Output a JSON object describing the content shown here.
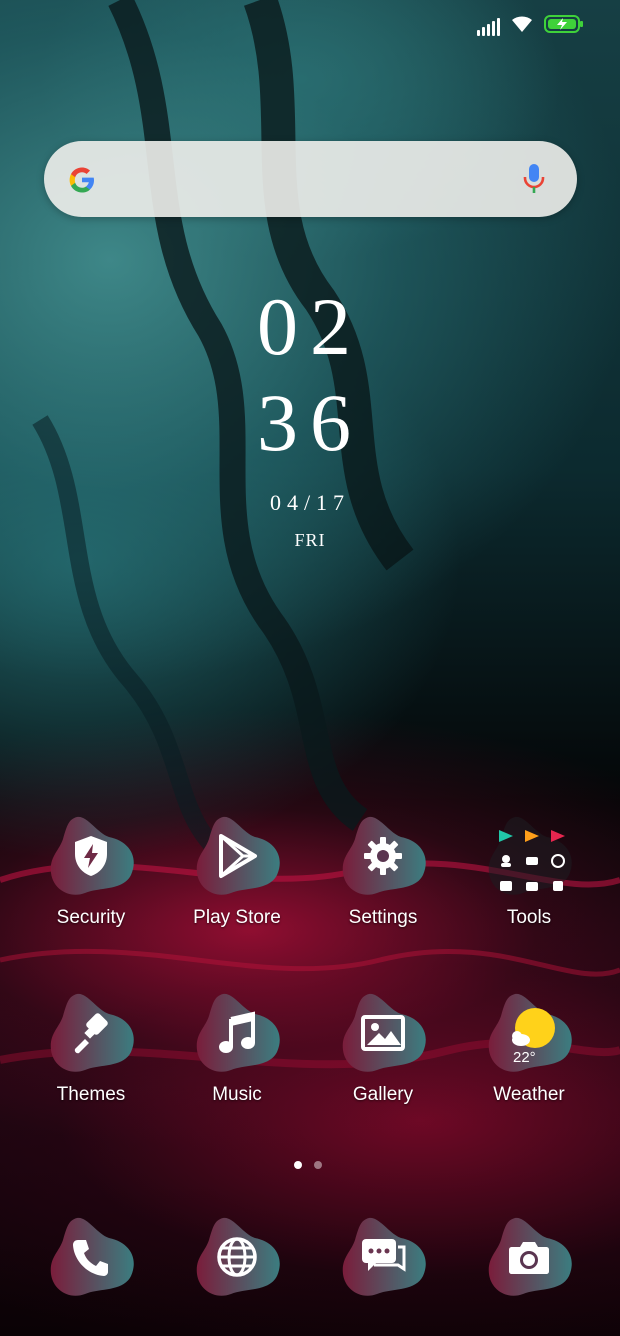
{
  "status": {
    "battery_color": "#3fd23a"
  },
  "search": {
    "placeholder": "",
    "value": ""
  },
  "clock": {
    "hour": "02",
    "minute": "36",
    "date": "04/17",
    "day": "FRI"
  },
  "apps": [
    {
      "label": "Security",
      "icon": "shield-bolt-icon"
    },
    {
      "label": "Play Store",
      "icon": "play-store-icon"
    },
    {
      "label": "Settings",
      "icon": "gear-icon"
    },
    {
      "label": "Tools",
      "icon": "folder-icon"
    },
    {
      "label": "Themes",
      "icon": "paintbrush-icon"
    },
    {
      "label": "Music",
      "icon": "music-note-icon"
    },
    {
      "label": "Gallery",
      "icon": "image-icon"
    },
    {
      "label": "Weather",
      "icon": "sun-cloud-icon"
    }
  ],
  "weather": {
    "temp": "22°"
  },
  "dock": [
    {
      "icon": "phone-icon"
    },
    {
      "icon": "globe-icon"
    },
    {
      "icon": "chat-icon"
    },
    {
      "icon": "camera-icon"
    }
  ],
  "pager": {
    "count": 2,
    "active": 0
  },
  "colors": {
    "blob_dark": "#7a1d3b",
    "blob_light": "#3b7d80",
    "google_blue": "#4285F4",
    "google_red": "#EA4335",
    "google_yellow": "#FBBC05",
    "google_green": "#34A853"
  }
}
